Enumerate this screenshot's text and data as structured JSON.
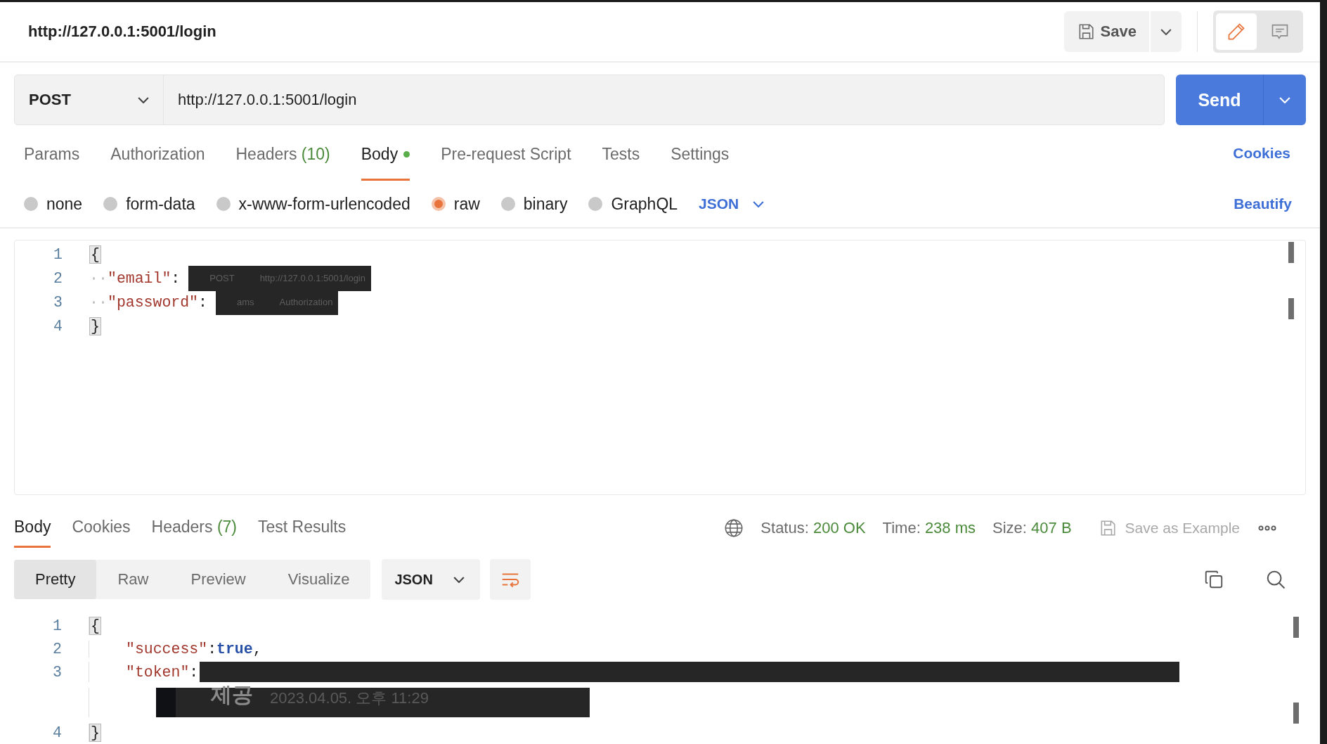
{
  "header": {
    "title": "http://127.0.0.1:5001/login",
    "save_label": "Save",
    "modes": [
      {
        "kind": "edit",
        "selected": true
      },
      {
        "kind": "comment",
        "selected": false
      }
    ]
  },
  "request": {
    "method": "POST",
    "url": "http://127.0.0.1:5001/login",
    "send_label": "Send"
  },
  "request_tabs": [
    {
      "label": "Params",
      "selected": false
    },
    {
      "label": "Authorization",
      "selected": false
    },
    {
      "label": "Headers",
      "count": "(10)",
      "selected": false
    },
    {
      "label": "Body",
      "selected": true,
      "modified": true
    },
    {
      "label": "Pre-request Script",
      "selected": false
    },
    {
      "label": "Tests",
      "selected": false
    },
    {
      "label": "Settings",
      "selected": false
    }
  ],
  "cookies_link": "Cookies",
  "body_types": [
    {
      "label": "none",
      "selected": false
    },
    {
      "label": "form-data",
      "selected": false
    },
    {
      "label": "x-www-form-urlencoded",
      "selected": false
    },
    {
      "label": "raw",
      "selected": true
    },
    {
      "label": "binary",
      "selected": false
    },
    {
      "label": "GraphQL",
      "selected": false
    }
  ],
  "body_format": "JSON",
  "beautify_label": "Beautify",
  "request_body": {
    "whitespace_markers": true,
    "lines": [
      {
        "number": "1",
        "tokens": [
          {
            "kind": "brace",
            "text": "{",
            "highlighted": true
          }
        ]
      },
      {
        "number": "2",
        "tokens": [
          {
            "kind": "key",
            "text": "\"email\""
          },
          {
            "kind": "punct",
            "text": ":"
          },
          {
            "kind": "redacted",
            "texts": [
              "POST",
              "http://127.0.0.1:5001/login"
            ]
          }
        ]
      },
      {
        "number": "3",
        "tokens": [
          {
            "kind": "key",
            "text": "\"password\""
          },
          {
            "kind": "punct",
            "text": ":"
          },
          {
            "kind": "redacted",
            "texts": [
              "ams",
              "Authorization"
            ]
          }
        ]
      },
      {
        "number": "4",
        "tokens": [
          {
            "kind": "brace",
            "text": "}",
            "highlighted": true
          }
        ]
      }
    ]
  },
  "response_tabs": [
    {
      "label": "Body",
      "selected": true
    },
    {
      "label": "Cookies",
      "selected": false
    },
    {
      "label": "Headers",
      "count": "(7)",
      "selected": false
    },
    {
      "label": "Test Results",
      "selected": false
    }
  ],
  "stats": [
    {
      "label": "Status:",
      "value": "200 OK"
    },
    {
      "label": "Time:",
      "value": "238 ms"
    },
    {
      "label": "Size:",
      "value": "407 B"
    }
  ],
  "save_example": {
    "label": "Save as Example",
    "disabled": true
  },
  "view_modes": [
    {
      "label": "Pretty",
      "selected": true
    },
    {
      "label": "Raw",
      "selected": false
    },
    {
      "label": "Preview",
      "selected": false
    },
    {
      "label": "Visualize",
      "selected": false
    }
  ],
  "response_format": "JSON",
  "response_body": {
    "lines": [
      {
        "number": "1",
        "tokens": [
          {
            "kind": "brace",
            "text": "{",
            "highlighted": true
          }
        ]
      },
      {
        "number": "2",
        "tokens": [
          {
            "kind": "key",
            "text": "\"success\""
          },
          {
            "kind": "punct",
            "text": ":"
          },
          {
            "kind": "bool",
            "text": "true"
          },
          {
            "kind": "punct",
            "text": ","
          }
        ]
      },
      {
        "number": "3",
        "tokens": [
          {
            "kind": "key",
            "text": "\"token\""
          },
          {
            "kind": "punct",
            "text": ":"
          },
          {
            "kind": "redacted"
          }
        ],
        "continuation": [
          {
            "kind": "redacted",
            "texts": [
              "제공",
              "2023.04.05. 오후 11:29"
            ]
          }
        ]
      },
      {
        "number": "4",
        "tokens": [
          {
            "kind": "brace",
            "text": "}",
            "highlighted": true
          }
        ]
      }
    ]
  }
}
